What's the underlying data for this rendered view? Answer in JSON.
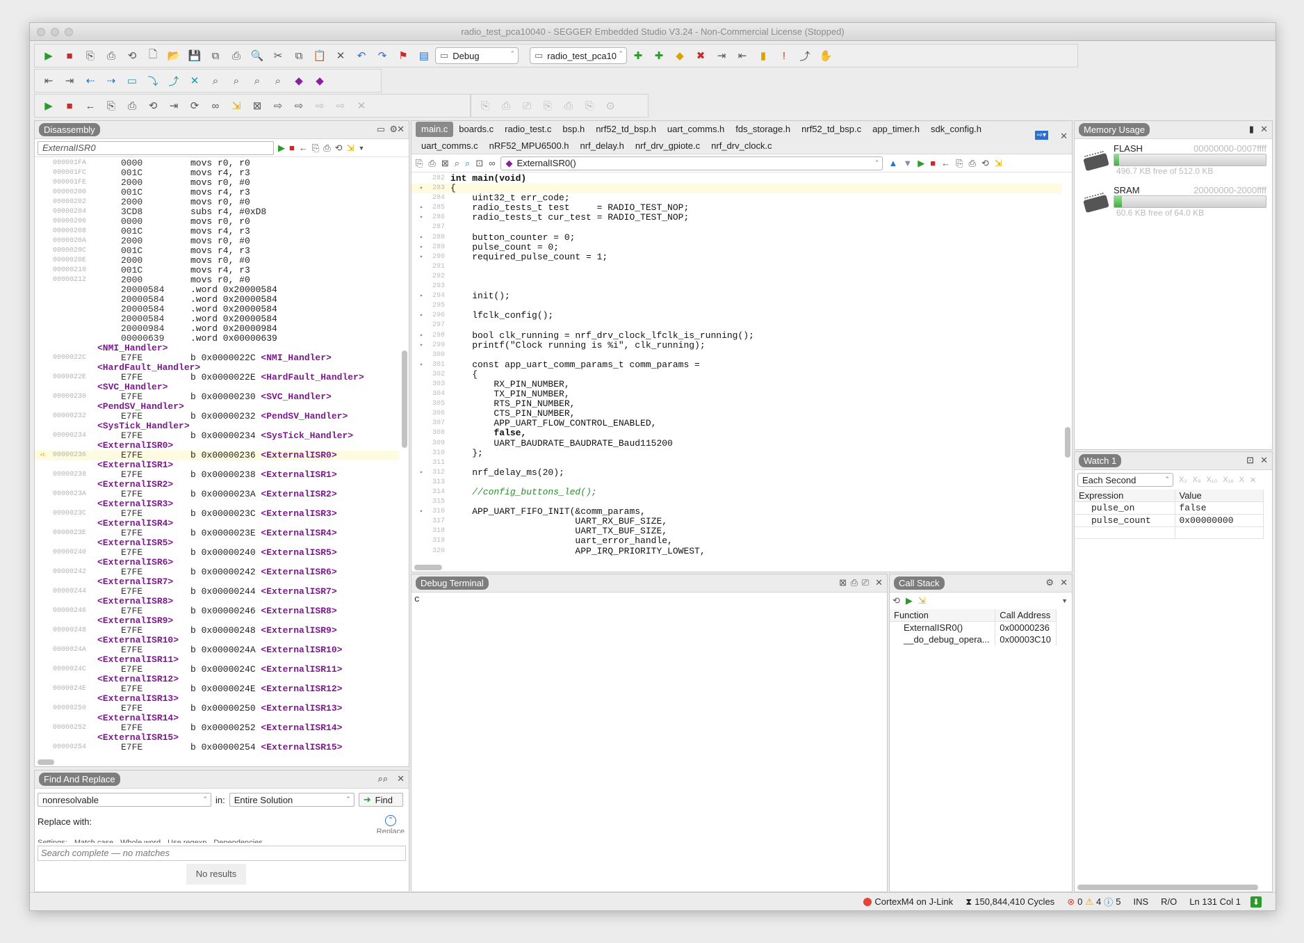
{
  "window": {
    "title": "radio_test_pca10040 - SEGGER Embedded Studio V3.24 - Non-Commercial License (Stopped)"
  },
  "toolbar": {
    "config": "Debug",
    "project": "radio_test_pca10"
  },
  "disassembly": {
    "title": "Disassembly",
    "search": "ExternalISR0",
    "rows": [
      {
        "a": "000001FA",
        "h": "0000",
        "i": "movs r0, r0"
      },
      {
        "a": "000001FC",
        "h": "001C",
        "i": "movs r4, r3"
      },
      {
        "a": "000001FE",
        "h": "2000",
        "i": "movs r0, #0"
      },
      {
        "a": "00000200",
        "h": "001C",
        "i": "movs r4, r3"
      },
      {
        "a": "00000202",
        "h": "2000",
        "i": "movs r0, #0"
      },
      {
        "a": "00000204",
        "h": "3CD8",
        "i": "subs r4, #0xD8"
      },
      {
        "a": "00000206",
        "h": "0000",
        "i": "movs r0, r0"
      },
      {
        "a": "00000208",
        "h": "001C",
        "i": "movs r4, r3"
      },
      {
        "a": "0000020A",
        "h": "2000",
        "i": "movs r0, #0"
      },
      {
        "a": "0000020C",
        "h": "001C",
        "i": "movs r4, r3"
      },
      {
        "a": "0000020E",
        "h": "2000",
        "i": "movs r0, #0"
      },
      {
        "a": "00000210",
        "h": "001C",
        "i": "movs r4, r3"
      },
      {
        "a": "00000212",
        "h": "2000",
        "i": "movs r0, #0"
      },
      {
        "a": "",
        "h": "20000584",
        "i": ".word 0x20000584"
      },
      {
        "a": "",
        "h": "20000584",
        "i": ".word 0x20000584"
      },
      {
        "a": "",
        "h": "20000584",
        "i": ".word 0x20000584"
      },
      {
        "a": "",
        "h": "20000584",
        "i": ".word 0x20000584"
      },
      {
        "a": "",
        "h": "20000984",
        "i": ".word 0x20000984"
      },
      {
        "a": "",
        "h": "00000639",
        "i": ".word 0x00000639"
      },
      {
        "l": "<NMI_Handler>"
      },
      {
        "a": "0000022C",
        "h": "E7FE",
        "i": "b 0x0000022C ",
        "t": "<NMI_Handler>"
      },
      {
        "l": "<HardFault_Handler>"
      },
      {
        "a": "0000022E",
        "h": "E7FE",
        "i": "b 0x0000022E ",
        "t": "<HardFault_Handler>"
      },
      {
        "l": "<SVC_Handler>"
      },
      {
        "a": "00000230",
        "h": "E7FE",
        "i": "b 0x00000230 ",
        "t": "<SVC_Handler>"
      },
      {
        "l": "<PendSV_Handler>"
      },
      {
        "a": "00000232",
        "h": "E7FE",
        "i": "b 0x00000232 ",
        "t": "<PendSV_Handler>"
      },
      {
        "l": "<SysTick_Handler>"
      },
      {
        "a": "00000234",
        "h": "E7FE",
        "i": "b 0x00000234 ",
        "t": "<SysTick_Handler>"
      },
      {
        "l": "<ExternalISR0>"
      },
      {
        "a": "00000236",
        "h": "E7FE",
        "i": "b 0x00000236 ",
        "t": "<ExternalISR0>",
        "cur": true
      },
      {
        "l": "<ExternalISR1>"
      },
      {
        "a": "00000238",
        "h": "E7FE",
        "i": "b 0x00000238 ",
        "t": "<ExternalISR1>"
      },
      {
        "l": "<ExternalISR2>"
      },
      {
        "a": "0000023A",
        "h": "E7FE",
        "i": "b 0x0000023A ",
        "t": "<ExternalISR2>"
      },
      {
        "l": "<ExternalISR3>"
      },
      {
        "a": "0000023C",
        "h": "E7FE",
        "i": "b 0x0000023C ",
        "t": "<ExternalISR3>"
      },
      {
        "l": "<ExternalISR4>"
      },
      {
        "a": "0000023E",
        "h": "E7FE",
        "i": "b 0x0000023E ",
        "t": "<ExternalISR4>"
      },
      {
        "l": "<ExternalISR5>"
      },
      {
        "a": "00000240",
        "h": "E7FE",
        "i": "b 0x00000240 ",
        "t": "<ExternalISR5>"
      },
      {
        "l": "<ExternalISR6>"
      },
      {
        "a": "00000242",
        "h": "E7FE",
        "i": "b 0x00000242 ",
        "t": "<ExternalISR6>"
      },
      {
        "l": "<ExternalISR7>"
      },
      {
        "a": "00000244",
        "h": "E7FE",
        "i": "b 0x00000244 ",
        "t": "<ExternalISR7>"
      },
      {
        "l": "<ExternalISR8>"
      },
      {
        "a": "00000246",
        "h": "E7FE",
        "i": "b 0x00000246 ",
        "t": "<ExternalISR8>"
      },
      {
        "l": "<ExternalISR9>"
      },
      {
        "a": "00000248",
        "h": "E7FE",
        "i": "b 0x00000248 ",
        "t": "<ExternalISR9>"
      },
      {
        "l": "<ExternalISR10>"
      },
      {
        "a": "0000024A",
        "h": "E7FE",
        "i": "b 0x0000024A ",
        "t": "<ExternalISR10>"
      },
      {
        "l": "<ExternalISR11>"
      },
      {
        "a": "0000024C",
        "h": "E7FE",
        "i": "b 0x0000024C ",
        "t": "<ExternalISR11>"
      },
      {
        "l": "<ExternalISR12>"
      },
      {
        "a": "0000024E",
        "h": "E7FE",
        "i": "b 0x0000024E ",
        "t": "<ExternalISR12>"
      },
      {
        "l": "<ExternalISR13>"
      },
      {
        "a": "00000250",
        "h": "E7FE",
        "i": "b 0x00000250 ",
        "t": "<ExternalISR13>"
      },
      {
        "l": "<ExternalISR14>"
      },
      {
        "a": "00000252",
        "h": "E7FE",
        "i": "b 0x00000252 ",
        "t": "<ExternalISR14>"
      },
      {
        "l": "<ExternalISR15>"
      },
      {
        "a": "00000254",
        "h": "E7FE",
        "i": "b 0x00000254 ",
        "t": "<ExternalISR15>"
      }
    ]
  },
  "find": {
    "title": "Find And Replace",
    "query": "nonresolvable",
    "in_label": "in:",
    "scope": "Entire Solution",
    "find_button": "Find",
    "replace_with": "Replace with:",
    "replace_button": "Replace",
    "settings": "Settings:",
    "options": [
      "Match case",
      "Whole word",
      "Use regexp",
      "Dependencies"
    ],
    "status": "Search complete — no matches",
    "results": "No results"
  },
  "editor": {
    "tabs_row1": [
      "main.c",
      "boards.c",
      "radio_test.c",
      "bsp.h",
      "nrf52_td_bsp.h",
      "uart_comms.h",
      "fds_storage.h",
      "nrf52_td_bsp.c",
      "app_timer.h",
      "sdk_config.h"
    ],
    "tabs_row2": [
      "uart_comms.c",
      "nRF52_MPU6500.h",
      "nrf_delay.h",
      "nrf_drv_gpiote.c",
      "nrf_drv_clock.c"
    ],
    "function": "ExternalISR0()",
    "lines": [
      {
        "n": "282",
        "c": "int main(void)"
      },
      {
        "n": "283",
        "c": "{",
        "m": true
      },
      {
        "n": "284",
        "c": "    uint32_t err_code;"
      },
      {
        "n": "285",
        "c": "    radio_tests_t test     = RADIO_TEST_NOP;",
        "m": true
      },
      {
        "n": "286",
        "c": "    radio_tests_t cur_test = RADIO_TEST_NOP;",
        "m": true
      },
      {
        "n": "287",
        "c": ""
      },
      {
        "n": "288",
        "c": "    button_counter = 0;",
        "m": true
      },
      {
        "n": "289",
        "c": "    pulse_count = 0;",
        "m": true
      },
      {
        "n": "290",
        "c": "    required_pulse_count = 1;",
        "m": true
      },
      {
        "n": "291",
        "c": ""
      },
      {
        "n": "292",
        "c": ""
      },
      {
        "n": "293",
        "c": ""
      },
      {
        "n": "294",
        "c": "    init();",
        "m": true
      },
      {
        "n": "295",
        "c": ""
      },
      {
        "n": "296",
        "c": "    lfclk_config();",
        "m": true
      },
      {
        "n": "297",
        "c": ""
      },
      {
        "n": "298",
        "c": "    bool clk_running = nrf_drv_clock_lfclk_is_running();",
        "m": true
      },
      {
        "n": "299",
        "c": "    printf(\"Clock running is %i\", clk_running);",
        "m": true
      },
      {
        "n": "300",
        "c": ""
      },
      {
        "n": "301",
        "c": "    const app_uart_comm_params_t comm_params =",
        "m": true
      },
      {
        "n": "302",
        "c": "    {"
      },
      {
        "n": "303",
        "c": "        RX_PIN_NUMBER,"
      },
      {
        "n": "304",
        "c": "        TX_PIN_NUMBER,"
      },
      {
        "n": "305",
        "c": "        RTS_PIN_NUMBER,"
      },
      {
        "n": "306",
        "c": "        CTS_PIN_NUMBER,"
      },
      {
        "n": "307",
        "c": "        APP_UART_FLOW_CONTROL_ENABLED,"
      },
      {
        "n": "308",
        "c": "        false,"
      },
      {
        "n": "309",
        "c": "        UART_BAUDRATE_BAUDRATE_Baud115200"
      },
      {
        "n": "310",
        "c": "    };"
      },
      {
        "n": "311",
        "c": ""
      },
      {
        "n": "312",
        "c": "    nrf_delay_ms(20);",
        "m": true
      },
      {
        "n": "313",
        "c": ""
      },
      {
        "n": "314",
        "c": "    //config_buttons_led();"
      },
      {
        "n": "315",
        "c": ""
      },
      {
        "n": "316",
        "c": "    APP_UART_FIFO_INIT(&comm_params,",
        "m": true
      },
      {
        "n": "317",
        "c": "                       UART_RX_BUF_SIZE,"
      },
      {
        "n": "318",
        "c": "                       UART_TX_BUF_SIZE,"
      },
      {
        "n": "319",
        "c": "                       uart_error_handle,"
      },
      {
        "n": "320",
        "c": "                       APP_IRQ_PRIORITY_LOWEST,"
      }
    ]
  },
  "terminal": {
    "title": "Debug Terminal",
    "content": "c"
  },
  "callstack": {
    "title": "Call Stack",
    "col_function": "Function",
    "col_address": "Call Address",
    "rows": [
      {
        "f": "ExternalISR0()",
        "a": "0x00000236"
      },
      {
        "f": "__do_debug_opera...",
        "a": "0x00003C10"
      }
    ]
  },
  "memory": {
    "title": "Memory Usage",
    "items": [
      {
        "name": "FLASH",
        "range": "00000000-0007ffff",
        "free": "496.7 KB free of 512.0 KB",
        "used_fraction": 0.03
      },
      {
        "name": "SRAM",
        "range": "20000000-2000ffff",
        "free": "60.6 KB free of 64.0 KB",
        "used_fraction": 0.05
      }
    ]
  },
  "watch": {
    "title": "Watch 1",
    "mode": "Each Second",
    "col_expr": "Expression",
    "col_value": "Value",
    "rows": [
      {
        "e": "pulse_on",
        "v": "false"
      },
      {
        "e": "pulse_count",
        "v": "0x00000000"
      }
    ]
  },
  "status": {
    "target": "CortexM4 on J-Link",
    "cycles": "150,844,410 Cycles",
    "errors": "0",
    "warnings": "4",
    "infos": "5",
    "mode": "INS",
    "rw": "R/O",
    "pos": "Ln 131 Col 1"
  }
}
